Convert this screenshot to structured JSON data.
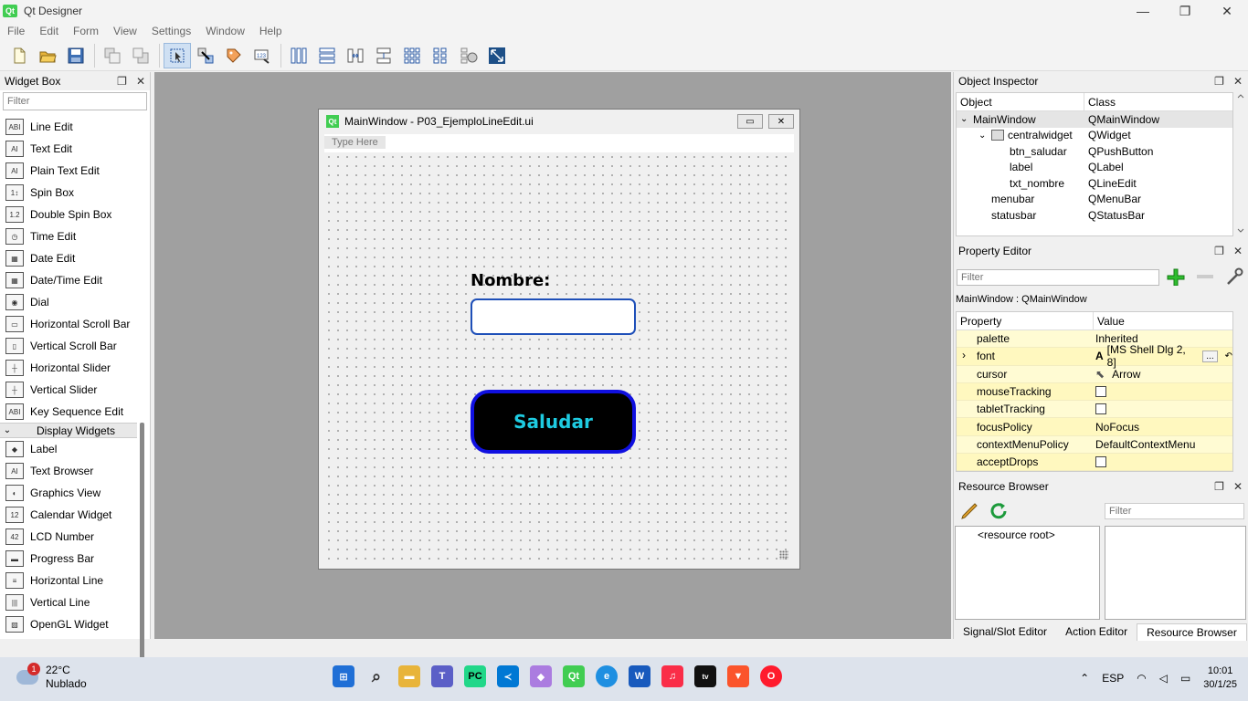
{
  "app": {
    "title": "Qt Designer",
    "icon_text": "Qt",
    "controls": {
      "minimize": "—",
      "restore": "❐",
      "close": "✕"
    }
  },
  "menu": [
    "File",
    "Edit",
    "Form",
    "View",
    "Settings",
    "Window",
    "Help"
  ],
  "widget_box": {
    "title": "Widget Box",
    "filter_placeholder": "Filter",
    "input_widgets": [
      {
        "label": "Line Edit",
        "icon": "line-edit-icon",
        "glyph": "ABI"
      },
      {
        "label": "Text Edit",
        "icon": "text-edit-icon",
        "glyph": "AI"
      },
      {
        "label": "Plain Text Edit",
        "icon": "plain-text-edit-icon",
        "glyph": "AI"
      },
      {
        "label": "Spin Box",
        "icon": "spin-box-icon",
        "glyph": "1↕"
      },
      {
        "label": "Double Spin Box",
        "icon": "double-spin-box-icon",
        "glyph": "1.2"
      },
      {
        "label": "Time Edit",
        "icon": "time-edit-icon",
        "glyph": "◷"
      },
      {
        "label": "Date Edit",
        "icon": "date-edit-icon",
        "glyph": "▦"
      },
      {
        "label": "Date/Time Edit",
        "icon": "date-time-edit-icon",
        "glyph": "▦"
      },
      {
        "label": "Dial",
        "icon": "dial-icon",
        "glyph": "◉"
      },
      {
        "label": "Horizontal Scroll Bar",
        "icon": "horizontal-scroll-bar-icon",
        "glyph": "▭"
      },
      {
        "label": "Vertical Scroll Bar",
        "icon": "vertical-scroll-bar-icon",
        "glyph": "▯"
      },
      {
        "label": "Horizontal Slider",
        "icon": "horizontal-slider-icon",
        "glyph": "┼"
      },
      {
        "label": "Vertical Slider",
        "icon": "vertical-slider-icon",
        "glyph": "┼"
      },
      {
        "label": "Key Sequence Edit",
        "icon": "key-sequence-edit-icon",
        "glyph": "ABI"
      }
    ],
    "display_category": "Display Widgets",
    "display_widgets": [
      {
        "label": "Label",
        "icon": "label-icon",
        "glyph": "◆"
      },
      {
        "label": "Text Browser",
        "icon": "text-browser-icon",
        "glyph": "AI"
      },
      {
        "label": "Graphics View",
        "icon": "graphics-view-icon",
        "glyph": "◐"
      },
      {
        "label": "Calendar Widget",
        "icon": "calendar-widget-icon",
        "glyph": "12"
      },
      {
        "label": "LCD Number",
        "icon": "lcd-number-icon",
        "glyph": "42"
      },
      {
        "label": "Progress Bar",
        "icon": "progress-bar-icon",
        "glyph": "▬"
      },
      {
        "label": "Horizontal Line",
        "icon": "horizontal-line-icon",
        "glyph": "≡"
      },
      {
        "label": "Vertical Line",
        "icon": "vertical-line-icon",
        "glyph": "|||"
      },
      {
        "label": "OpenGL Widget",
        "icon": "opengl-widget-icon",
        "glyph": "▨"
      }
    ]
  },
  "form_window": {
    "title": "MainWindow - P03_EjemploLineEdit.ui",
    "menu_placeholder": "Type Here",
    "label_text": "Nombre:",
    "button_text": "Saludar",
    "button_colors": {
      "background": "#000000",
      "border": "#1010e0",
      "text": "#1ecbe1"
    },
    "line_edit_border": "#1e4fb8"
  },
  "object_inspector": {
    "title": "Object Inspector",
    "columns": [
      "Object",
      "Class"
    ],
    "rows": [
      {
        "object": "MainWindow",
        "class": "QMainWindow",
        "indent": 0,
        "expander": "⌄",
        "selected": true
      },
      {
        "object": "centralwidget",
        "class": "QWidget",
        "indent": 1,
        "expander": "⌄",
        "selected": false
      },
      {
        "object": "btn_saludar",
        "class": "QPushButton",
        "indent": 2,
        "expander": "",
        "selected": false
      },
      {
        "object": "label",
        "class": "QLabel",
        "indent": 2,
        "expander": "",
        "selected": false
      },
      {
        "object": "txt_nombre",
        "class": "QLineEdit",
        "indent": 2,
        "expander": "",
        "selected": false
      },
      {
        "object": "menubar",
        "class": "QMenuBar",
        "indent": 1,
        "expander": "",
        "selected": false
      },
      {
        "object": "statusbar",
        "class": "QStatusBar",
        "indent": 1,
        "expander": "",
        "selected": false
      }
    ]
  },
  "property_editor": {
    "title": "Property Editor",
    "filter_placeholder": "Filter",
    "class_line": "MainWindow : QMainWindow",
    "columns": [
      "Property",
      "Value"
    ],
    "rows": [
      {
        "property": "palette",
        "value": "Inherited",
        "type": "text"
      },
      {
        "property": "font",
        "value": "[MS Shell Dlg 2, 8]",
        "type": "font"
      },
      {
        "property": "cursor",
        "value": "Arrow",
        "type": "cursor"
      },
      {
        "property": "mouseTracking",
        "value": "",
        "type": "check"
      },
      {
        "property": "tabletTracking",
        "value": "",
        "type": "check"
      },
      {
        "property": "focusPolicy",
        "value": "NoFocus",
        "type": "text"
      },
      {
        "property": "contextMenuPolicy",
        "value": "DefaultContextMenu",
        "type": "text"
      },
      {
        "property": "acceptDrops",
        "value": "",
        "type": "check"
      }
    ],
    "font_glyph": "A",
    "ellipsis": "..."
  },
  "resource_browser": {
    "title": "Resource Browser",
    "filter_placeholder": "Filter",
    "root": "<resource root>",
    "tabs": [
      "Signal/Slot Editor",
      "Action Editor",
      "Resource Browser"
    ]
  },
  "taskbar": {
    "temperature": "22°C",
    "condition": "Nublado",
    "badge": "1",
    "language": "ESP",
    "time": "10:01",
    "date": "30/1/25"
  }
}
